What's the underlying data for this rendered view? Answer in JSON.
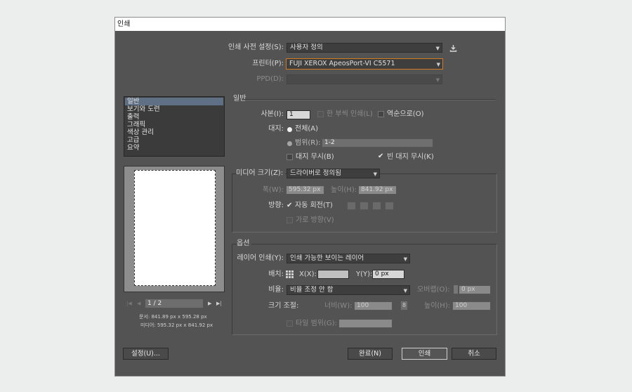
{
  "window": {
    "title": "인쇄"
  },
  "top": {
    "preset_label": "인쇄 사전 설정(S):",
    "preset_value": "사용자 정의",
    "printer_label": "프린터(P):",
    "printer_value": "FUJI XEROX ApeosPort-VI C5571",
    "ppd_label": "PPD(D):",
    "ppd_value": ""
  },
  "sidebar": {
    "items": [
      {
        "label": "일반"
      },
      {
        "label": "보기와 도련"
      },
      {
        "label": "출력"
      },
      {
        "label": "그래픽"
      },
      {
        "label": "색상 관리"
      },
      {
        "label": "고급"
      },
      {
        "label": "요약"
      }
    ],
    "selected_index": 0
  },
  "preview": {
    "page_indicator": "1 / 2",
    "document_size": "문서: 841.89 px x 595.28 px",
    "media_size": "미디어: 595.32 px x 841.92 px"
  },
  "general": {
    "section_title": "일반",
    "copies_label": "사본(I):",
    "copies_value": "1",
    "collate_label": "한 부씩 인쇄(L)",
    "reverse_label": "역순으로(O)",
    "pages_label": "대지:",
    "all_label": "전체(A)",
    "range_label": "범위(R):",
    "range_value": "1-2",
    "ignore_artboards_label": "대지 무시(B)",
    "skip_blank_label": "빈 대지 무시(K)"
  },
  "media": {
    "size_label": "미디어 크기(Z):",
    "size_value": "드라이버로 정의됨",
    "width_label": "폭(W):",
    "width_value": "595.32 px",
    "height_label": "높이(H):",
    "height_value": "841.92 px",
    "orientation_label": "방향:",
    "auto_rotate_label": "자동 회전(T)",
    "transverse_label": "가로 방향(V)"
  },
  "options": {
    "section_title": "옵션",
    "layers_label": "레이어 인쇄(Y):",
    "layers_value": "인쇄 가능한 보이는 레이어",
    "placement_label": "배치:",
    "x_label": "X(X):",
    "x_value": "",
    "y_label": "Y(Y):",
    "y_value": "0 px",
    "scaling_label": "비율:",
    "scaling_value": "비율 조정 안 함",
    "overlap_label": "오버랩(O):",
    "overlap_value": "0 px",
    "scale_label": "크기 조절:",
    "scale_width_label": "너비(W):",
    "scale_width_value": "100",
    "scale_height_label": "높이(H):",
    "scale_height_value": "100",
    "tile_range_label": "타일 범위(G):",
    "tile_range_value": ""
  },
  "buttons": {
    "setup": "설정(U)...",
    "done": "완료(N)",
    "print": "인쇄",
    "cancel": "취소"
  }
}
